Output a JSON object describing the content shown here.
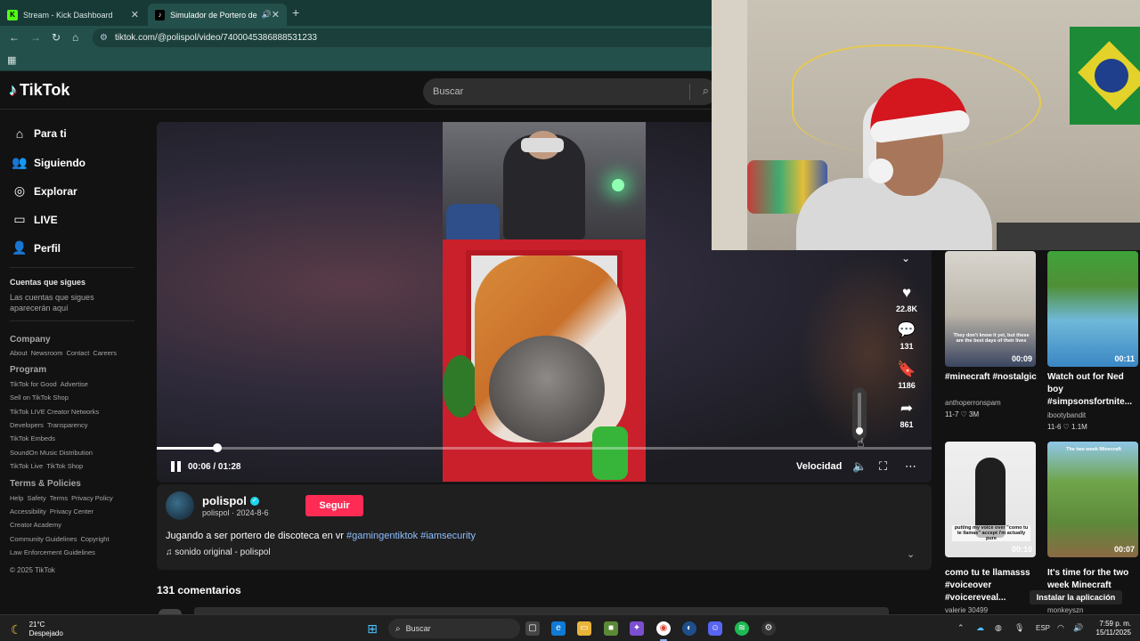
{
  "browser": {
    "tabs": [
      {
        "title": "Stream - Kick Dashboard",
        "favicon": "kick-icon"
      },
      {
        "title": "Simulador de Portero de D",
        "favicon": "tiktok-icon"
      }
    ],
    "url": "tiktok.com/@polispol/video/7400045386888531233"
  },
  "header": {
    "logo": "TikTok",
    "search_placeholder": "Buscar"
  },
  "sidebar": {
    "nav": [
      "Para ti",
      "Siguiendo",
      "Explorar",
      "LIVE",
      "Perfil"
    ],
    "following_title": "Cuentas que sigues",
    "following_empty": "Las cuentas que sigues aparecerán aquí",
    "company_title": "Company",
    "company_links": [
      "About",
      "Newsroom",
      "Contact",
      "Careers"
    ],
    "program_title": "Program",
    "program_lines": [
      [
        "TikTok for Good",
        "Advertise"
      ],
      [
        "Sell on TikTok Shop"
      ],
      [
        "TikTok LIVE Creator Networks"
      ],
      [
        "Developers",
        "Transparency"
      ],
      [
        "TikTok Embeds"
      ],
      [
        "SoundOn Music Distribution"
      ],
      [
        "TikTok Live",
        "TikTok Shop"
      ]
    ],
    "terms_title": "Terms & Policies",
    "terms_lines": [
      [
        "Help",
        "Safety",
        "Terms",
        "Privacy Policy"
      ],
      [
        "Accessibility",
        "Privacy Center"
      ],
      [
        "Creator Academy"
      ],
      [
        "Community Guidelines",
        "Copyright"
      ],
      [
        "Law Enforcement Guidelines"
      ]
    ],
    "copyright": "© 2025 TikTok"
  },
  "player": {
    "time": "00:06 / 01:28",
    "progress": 0.078,
    "volume": 0.1,
    "speed_label": "Velocidad",
    "likes": "22.8K",
    "comments": "131",
    "saves": "1186",
    "shares": "861"
  },
  "post": {
    "username": "polispol",
    "handle_date": "polispol · 2024-8-6",
    "follow_label": "Seguir",
    "caption": "Jugando a ser portero de discoteca en vr",
    "tags": [
      "#gamingentiktok",
      "#iamsecurity"
    ],
    "sound": "♫ sonido original - polispol",
    "comments_heading": "131 comentarios"
  },
  "related": [
    {
      "duration": "00:09",
      "title": "#minecraft #nostalgic",
      "author": "anthoperronspam",
      "stats": "11-7 ♡ 3M",
      "caption": "They don't know it yet, but these are the best days of their lives"
    },
    {
      "duration": "00:11",
      "title": "Watch out for Ned boy #simpsonsfortnite...",
      "author": "ibootybandit",
      "stats": "11-6 ♡ 1.1M",
      "caption": ""
    },
    {
      "duration": "00:10",
      "title": "como tu te llamasss #voiceover #voicereveal...",
      "author": "valerie 30499",
      "stats": "",
      "caption": "putting my voice over \"como tu te llamas\" accept i'm actually pure"
    },
    {
      "duration": "00:07",
      "title": "It's time for the two week Minecraft",
      "author": "monkeyszn",
      "stats": "",
      "caption": "The two week Minecraft"
    }
  ],
  "install_label": "Instalar la aplicación",
  "taskbar": {
    "temp": "21°C",
    "weather": "Despejado",
    "search": "Buscar",
    "lang": "ESP",
    "time": "7:59 p. m.",
    "date": "15/11/2025"
  },
  "colors": {
    "accent": "#fe2c55",
    "browser": "#24504b",
    "hashtag": "#8fbfff"
  }
}
